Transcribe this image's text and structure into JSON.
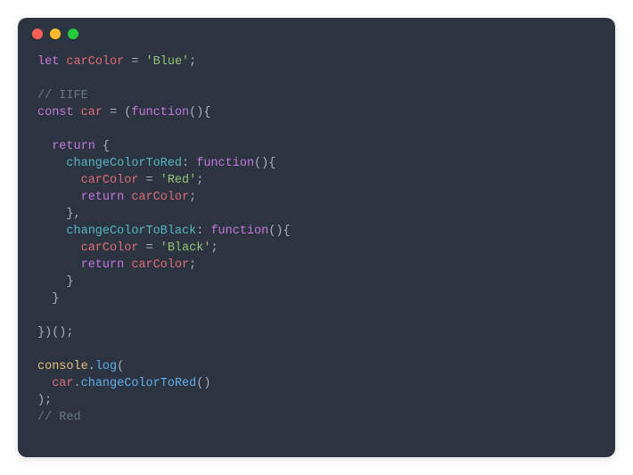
{
  "code": {
    "l1_let": "let",
    "l1_var": "carColor",
    "l1_eq": " = ",
    "l1_str": "'Blue'",
    "l1_semi": ";",
    "l3_com": "// IIFE",
    "l4_const": "const",
    "l4_var": "car",
    "l4_eq": " = (",
    "l4_fn": "function",
    "l4_paren": "(){",
    "l6_ret": "return",
    "l6_brace": " {",
    "l7_prop": "changeColorToRed",
    "l7_colon": ": ",
    "l7_fn": "function",
    "l7_paren": "(){",
    "l8_var": "carColor",
    "l8_eq": " = ",
    "l8_str": "'Red'",
    "l8_semi": ";",
    "l9_ret": "return",
    "l9_var": " carColor",
    "l9_semi": ";",
    "l10_brace": "},",
    "l11_prop": "changeColorToBlack",
    "l11_colon": ": ",
    "l11_fn": "function",
    "l11_paren": "(){",
    "l12_var": "carColor",
    "l12_eq": " = ",
    "l12_str": "'Black'",
    "l12_semi": ";",
    "l13_ret": "return",
    "l13_var": " carColor",
    "l13_semi": ";",
    "l14_brace": "}",
    "l15_brace": "}",
    "l17_close": "})();",
    "l19_console": "console",
    "l19_dot": ".",
    "l19_log": "log",
    "l19_open": "(",
    "l20_car": "car",
    "l20_dot": ".",
    "l20_method": "changeColorToRed",
    "l20_paren": "()",
    "l21_close": ");",
    "l22_com": "// Red"
  }
}
